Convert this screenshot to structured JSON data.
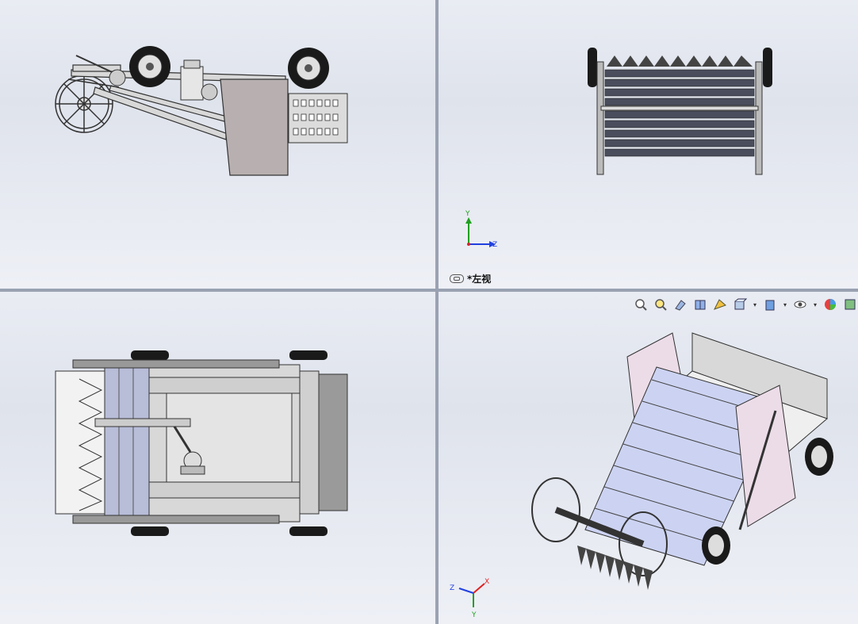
{
  "viewports": {
    "top_right": {
      "view_name": "*左视"
    }
  },
  "triad": {
    "x_label": "X",
    "y_label": "Y",
    "z_label": "Z"
  },
  "heads_up_toolbar": {
    "icons": [
      "zoom-to-fit-icon",
      "zoom-to-area-icon",
      "previous-view-icon",
      "section-view-icon",
      "dynamic-annotation-icon",
      "view-orientation-icon",
      "display-style-icon",
      "hide-show-items-icon",
      "edit-appearance-icon",
      "apply-scene-icon"
    ]
  },
  "colors": {
    "frame_gray": "#c9c9c9",
    "panel_mauve": "#ecdce8",
    "conveyor_blue": "#ccd3f2",
    "belt_dark": "#4a4d5c",
    "tire_black": "#1a1a1a",
    "triad_red": "#e02020",
    "triad_green": "#20a020",
    "triad_blue": "#2040e0"
  }
}
